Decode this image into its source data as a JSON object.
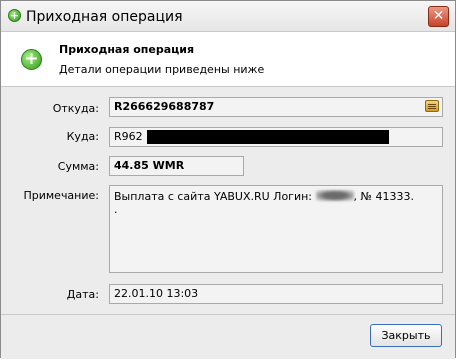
{
  "window": {
    "title": "Приходная операция",
    "close_glyph": "✕"
  },
  "header": {
    "title": "Приходная операция",
    "subtitle": "Детали операции приведены ниже",
    "icon": "plus-circle-icon"
  },
  "fields": {
    "from_label": "Откуда:",
    "from_value": "R266629688787",
    "to_label": "Куда:",
    "to_value": "R962",
    "amount_label": "Сумма:",
    "amount_value": "44.85 WMR",
    "note_label": "Примечание:",
    "note_text_before": "Выплата с сайта YABUX.RU Логин: ",
    "note_text_after": ", № 41333.",
    "note_second_line": ".",
    "date_label": "Дата:",
    "date_value": "22.01.10 13:03"
  },
  "footer": {
    "close_button": "Закрыть"
  },
  "colors": {
    "accent_green": "#2f9a1a",
    "window_bg": "#ececec"
  }
}
